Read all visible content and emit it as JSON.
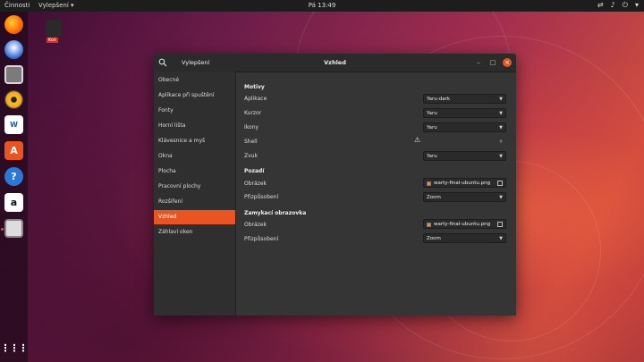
{
  "topbar": {
    "activities": "Činnosti",
    "app_menu": "Vylepšení ▾",
    "clock": "Pá 13:49",
    "tray": [
      "network-icon",
      "volume-icon",
      "power-icon"
    ]
  },
  "dock": {
    "items": [
      "firefox-icon",
      "thunderbird-icon",
      "files-icon",
      "rhythmbox-icon",
      "writer-icon",
      "software-center-icon",
      "help-icon",
      "amazon-icon",
      "tweaks-icon"
    ],
    "show_apps_icon": "grid-icon"
  },
  "desktop": {
    "trash_label": "Koš"
  },
  "window": {
    "sidebar_title": "Vylepšení",
    "title": "Vzhled",
    "sidebar": [
      "Obecné",
      "Aplikace při spuštění",
      "Fonty",
      "Horní lišta",
      "Klávesnice a myš",
      "Okna",
      "Plocha",
      "Pracovní plochy",
      "Rozšíření",
      "Vzhled",
      "Záhlaví oken"
    ],
    "active_index": 9,
    "sections": {
      "motivy": {
        "title": "Motivy",
        "rows": [
          {
            "label": "Aplikace",
            "value": "Yaru-dark"
          },
          {
            "label": "Kurzor",
            "value": "Yaru"
          },
          {
            "label": "Ikony",
            "value": "Yaru"
          },
          {
            "label": "Shell",
            "value": ""
          },
          {
            "label": "Zvuk",
            "value": "Yaru"
          }
        ]
      },
      "pozadi": {
        "title": "Pozadí",
        "image_label": "Obrázek",
        "image_value": "warty-final-ubuntu.png",
        "fit_label": "Přizpůsobení",
        "fit_value": "Zoom"
      },
      "zamykaci": {
        "title": "Zamykací obrazovka",
        "image_label": "Obrázek",
        "image_value": "warty-final-ubuntu.png",
        "fit_label": "Přizpůsobení",
        "fit_value": "Zoom"
      }
    }
  },
  "colors": {
    "accent": "#e95420",
    "window_bg": "#353535",
    "sidebar_bg": "#2f2f2f"
  }
}
